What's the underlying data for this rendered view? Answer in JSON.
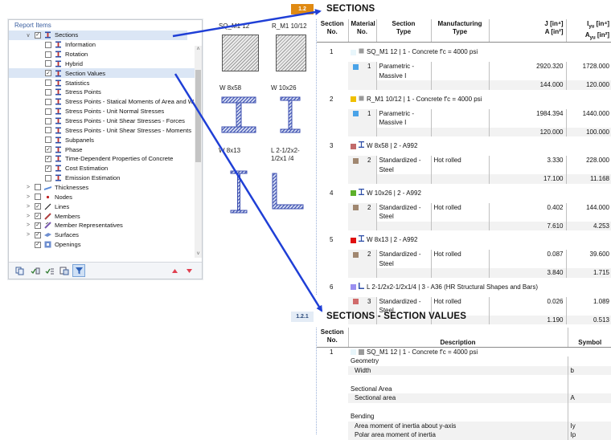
{
  "panel": {
    "title": "Report Items",
    "items": [
      {
        "label": "Sections",
        "level": 1,
        "expander": "∨",
        "checked": true,
        "selected": true,
        "icon": "sections-icon"
      },
      {
        "label": "Information",
        "level": 2,
        "checked": false,
        "icon": "sections-icon"
      },
      {
        "label": "Rotation",
        "level": 2,
        "checked": false,
        "icon": "sections-icon"
      },
      {
        "label": "Hybrid",
        "level": 2,
        "checked": false,
        "icon": "sections-icon"
      },
      {
        "label": "Section Values",
        "level": 2,
        "checked": true,
        "selected": true,
        "icon": "sections-icon"
      },
      {
        "label": "Statistics",
        "level": 2,
        "checked": false,
        "icon": "sections-icon"
      },
      {
        "label": "Stress Points",
        "level": 2,
        "checked": false,
        "icon": "sections-icon"
      },
      {
        "label": "Stress Points - Statical Moments of Area and W",
        "level": 2,
        "checked": false,
        "icon": "sections-icon"
      },
      {
        "label": "Stress Points - Unit Normal Stresses",
        "level": 2,
        "checked": false,
        "icon": "sections-icon"
      },
      {
        "label": "Stress Points - Unit Shear Stresses - Forces",
        "level": 2,
        "checked": false,
        "icon": "sections-icon"
      },
      {
        "label": "Stress Points - Unit Shear Stresses - Moments",
        "level": 2,
        "checked": false,
        "icon": "sections-icon"
      },
      {
        "label": "Subpanels",
        "level": 2,
        "checked": false,
        "icon": "sections-icon"
      },
      {
        "label": "Phase",
        "level": 2,
        "checked": true,
        "icon": "sections-icon"
      },
      {
        "label": "Time-Dependent Properties of Concrete",
        "level": 2,
        "checked": true,
        "icon": "sections-icon"
      },
      {
        "label": "Cost Estimation",
        "level": 2,
        "checked": true,
        "icon": "sections-icon"
      },
      {
        "label": "Emission Estimation",
        "level": 2,
        "checked": false,
        "icon": "sections-icon"
      },
      {
        "label": "Thicknesses",
        "level": 1,
        "expander": ">",
        "checked": false,
        "icon": "thickness-icon"
      },
      {
        "label": "Nodes",
        "level": 1,
        "expander": ">",
        "checked": false,
        "icon": "node-icon"
      },
      {
        "label": "Lines",
        "level": 1,
        "expander": ">",
        "checked": true,
        "icon": "line-icon"
      },
      {
        "label": "Members",
        "level": 1,
        "expander": ">",
        "checked": true,
        "icon": "member-icon"
      },
      {
        "label": "Member Representatives",
        "level": 1,
        "expander": ">",
        "checked": true,
        "icon": "member-representative-icon"
      },
      {
        "label": "Surfaces",
        "level": 1,
        "expander": ">",
        "checked": true,
        "icon": "surface-icon"
      },
      {
        "label": "Openings",
        "level": 1,
        "expander": "",
        "checked": true,
        "icon": "opening-icon"
      }
    ],
    "toolbar_icons": [
      "copy-icon",
      "check-all-icon",
      "check-selected-icon",
      "copy-settings-icon",
      "filter-icon",
      "move-up-icon",
      "move-down-icon"
    ]
  },
  "previews": [
    {
      "label": "SQ_M1 12",
      "shape": "square"
    },
    {
      "label": "R_M1 10/12",
      "shape": "square"
    },
    {
      "label": "W 8x58",
      "shape": "i-beam-wide"
    },
    {
      "label": "W 10x26",
      "shape": "i-beam"
    },
    {
      "label": "W 8x13",
      "shape": "i-beam-tall"
    },
    {
      "label": "L 2-1/2x2-1/2x1 /4",
      "shape": "angle"
    }
  ],
  "sections_report": {
    "number": "1.2",
    "title": "SECTIONS",
    "headers": [
      "Section No.",
      "Material No.",
      "Section Type",
      "Manufacturing Type",
      "J [in⁴] / A [in²]",
      "Iyu [in⁴] / Ayu [in²]"
    ],
    "header_col1": [
      "Section",
      "No."
    ],
    "header_col2": [
      "Material",
      "No."
    ],
    "header_col3": [
      "Section",
      "Type"
    ],
    "header_col4": [
      "Manufacturing",
      "Type"
    ],
    "header_col5": [
      "J [in⁴]",
      "A [in²]"
    ],
    "header_col6": [
      "I",
      "A",
      "yu",
      "[in⁴]",
      "[in²]"
    ],
    "rows": [
      {
        "no": "1",
        "color": "#e8f6fb",
        "shape_icon": "square-icon",
        "name": "SQ_M1 12 | 1 - Concrete f'c = 4000 psi",
        "mat_color": "#4aa3e8",
        "mat": "1",
        "type1": "Parametric -",
        "type2": "Massive I",
        "manuf": "",
        "j": "2920.320",
        "iyu": "1728.000",
        "a": "144.000",
        "ayu": "120.000"
      },
      {
        "no": "2",
        "color": "#f0c000",
        "shape_icon": "rectangle-icon",
        "name": "R_M1 10/12 | 1 - Concrete f'c = 4000 psi",
        "mat_color": "#4aa3e8",
        "mat": "1",
        "type1": "Parametric -",
        "type2": "Massive I",
        "manuf": "",
        "j": "1984.394",
        "iyu": "1440.000",
        "a": "120.000",
        "ayu": "100.000"
      },
      {
        "no": "3",
        "color": "#c26b6b",
        "shape_icon": "i-section-icon",
        "name": "W 8x58 | 2 - A992",
        "mat_color": "#a08770",
        "mat": "2",
        "type1": "Standardized -",
        "type2": "Steel",
        "manuf": "Hot rolled",
        "j": "3.330",
        "iyu": "228.000",
        "a": "17.100",
        "ayu": "11.168"
      },
      {
        "no": "4",
        "color": "#5db02a",
        "shape_icon": "i-section-icon",
        "name": "W 10x26 | 2 - A992",
        "mat_color": "#a08770",
        "mat": "2",
        "type1": "Standardized -",
        "type2": "Steel",
        "manuf": "Hot rolled",
        "j": "0.402",
        "iyu": "144.000",
        "a": "7.610",
        "ayu": "4.253"
      },
      {
        "no": "5",
        "color": "#e01010",
        "shape_icon": "i-section-icon",
        "name": "W 8x13 | 2 - A992",
        "mat_color": "#a08770",
        "mat": "2",
        "type1": "Standardized -",
        "type2": "Steel",
        "manuf": "Hot rolled",
        "j": "0.087",
        "iyu": "39.600",
        "a": "3.840",
        "ayu": "1.715"
      },
      {
        "no": "6",
        "color": "#9a8ff0",
        "shape_icon": "angle-section-icon",
        "name": "L 2-1/2x2-1/2x1/4 | 3 - A36 (HR Structural Shapes and Bars)",
        "mat_color": "#d06a6a",
        "mat": "3",
        "type1": "Standardized -",
        "type2": "Steel",
        "manuf": "Hot rolled",
        "j": "0.026",
        "iyu": "1.089",
        "a": "1.190",
        "ayu": "0.513"
      }
    ]
  },
  "values_report": {
    "number": "1.2.1",
    "title": "SECTIONS - SECTION VALUES",
    "header_col1": [
      "Section",
      "No."
    ],
    "header_desc": "Description",
    "header_symbol": "Symbol",
    "section_no": "1",
    "section_color": "#e8f6fb",
    "section_name": "SQ_M1 12 | 1 - Concrete f'c = 4000 psi",
    "lines": [
      {
        "kind": "group",
        "text": "Geometry",
        "symbol": ""
      },
      {
        "kind": "item",
        "text": "Width",
        "symbol": "b"
      },
      {
        "kind": "blank",
        "text": "",
        "symbol": ""
      },
      {
        "kind": "group",
        "text": "Sectional Area",
        "symbol": ""
      },
      {
        "kind": "item",
        "text": "Sectional area",
        "symbol": "A"
      },
      {
        "kind": "blank",
        "text": "",
        "symbol": ""
      },
      {
        "kind": "group",
        "text": "Bending",
        "symbol": ""
      },
      {
        "kind": "item",
        "text": "Area moment of inertia about y-axis",
        "symbol": "Iy"
      },
      {
        "kind": "item",
        "text": "Polar area moment of inertia",
        "symbol": "Ip"
      }
    ]
  },
  "colors": {
    "accent_badge": "#e08a12",
    "badge_light": "#e4ecf6",
    "arrow": "#1f3fd6"
  }
}
